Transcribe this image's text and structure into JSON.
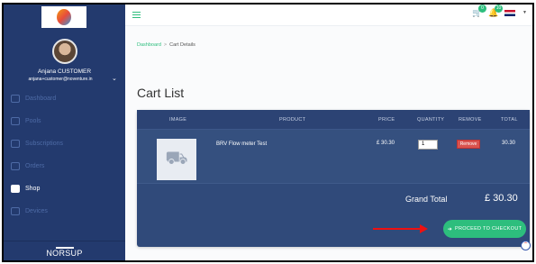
{
  "user": {
    "name": "Anjana CUSTOMER",
    "email": "anjana+customer@noventure.in"
  },
  "sidebar": {
    "items": [
      {
        "label": "Dashboard",
        "icon": "dashboard-icon"
      },
      {
        "label": "Pools",
        "icon": "pools-icon"
      },
      {
        "label": "Subscriptions",
        "icon": "subscriptions-icon"
      },
      {
        "label": "Orders",
        "icon": "orders-icon"
      },
      {
        "label": "Shop",
        "icon": "shop-icon"
      },
      {
        "label": "Devices",
        "icon": "devices-icon"
      }
    ],
    "active": "Shop",
    "footer_brand": "NORSUP"
  },
  "topbar": {
    "cart_count": "0",
    "notif_count": "10"
  },
  "breadcrumb": {
    "home": "Dashboard",
    "separator": ">",
    "current": "Cart Details"
  },
  "page_title": "Cart List",
  "table": {
    "headers": {
      "image": "IMAGE",
      "product": "PRODUCT",
      "price": "PRICE",
      "quantity": "QUANTITY",
      "remove": "REMOVE",
      "total": "TOTAL"
    },
    "rows": [
      {
        "product": "BRV Flow meter Test",
        "price": "£ 30.30",
        "quantity": "1",
        "remove_label": "Remove",
        "total": "30.30"
      }
    ]
  },
  "grand_total": {
    "label": "Grand Total",
    "value": "£ 30.30"
  },
  "checkout_label": "PROCEED TO CHECKOUT",
  "colors": {
    "accent": "#2dbe7d",
    "sidebar": "#233a6e",
    "panel": "#304a7a",
    "remove": "#d9534f"
  }
}
